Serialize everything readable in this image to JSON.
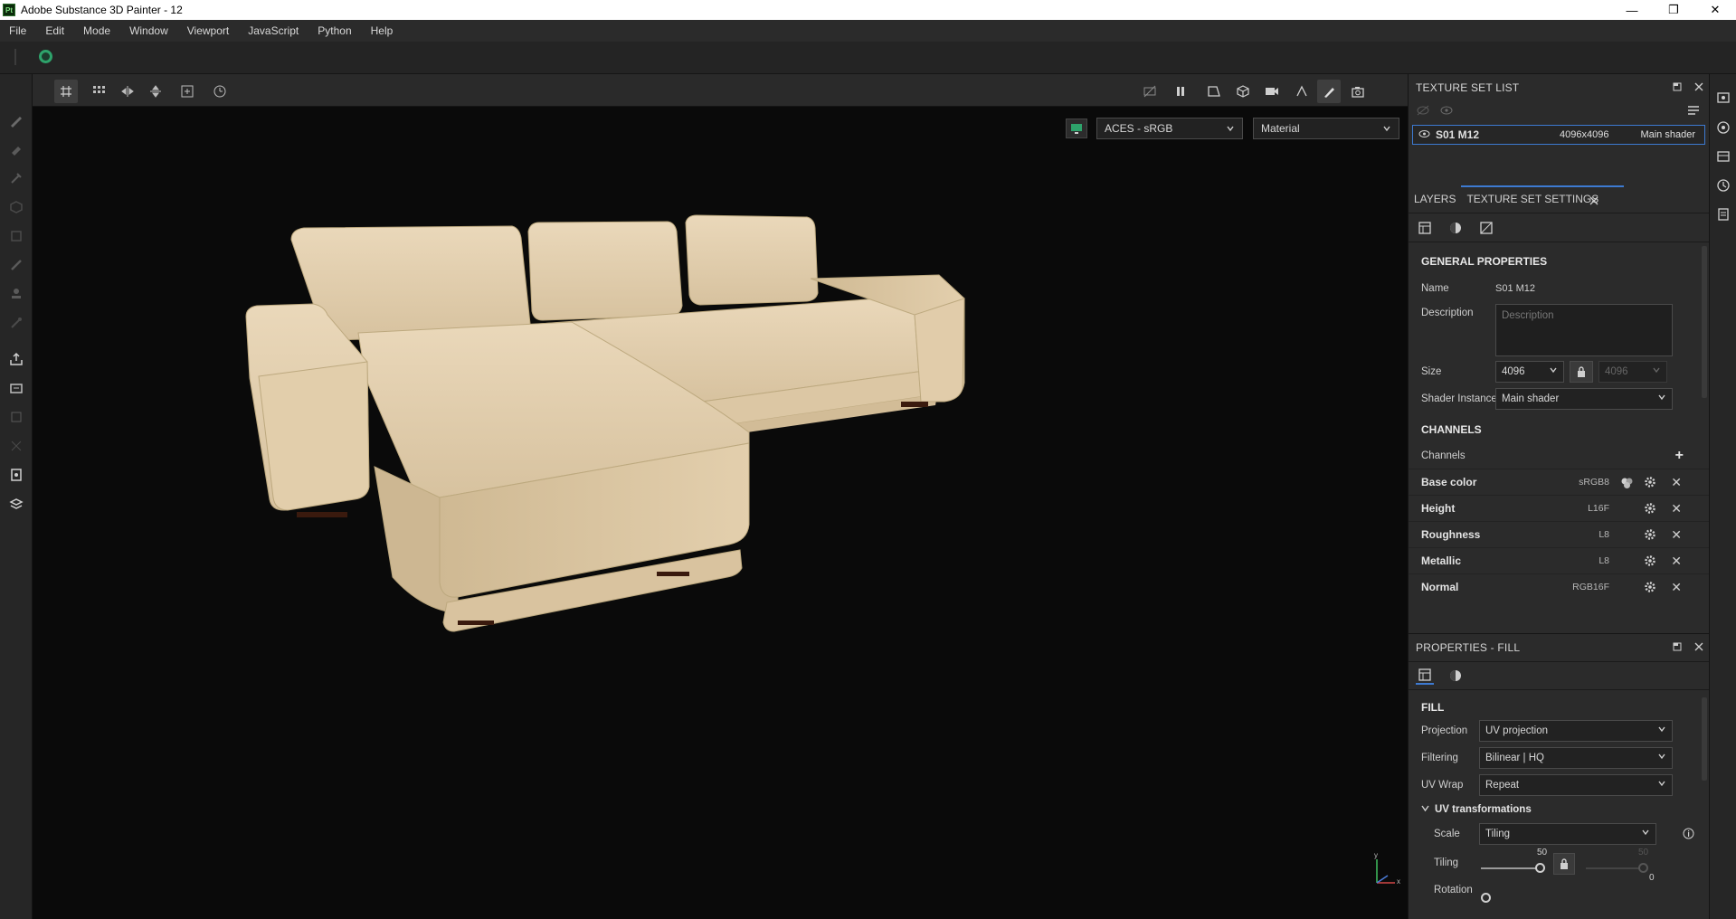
{
  "window": {
    "title": "Adobe Substance 3D Painter - 12",
    "logo_text": "Pt",
    "minimize": "—",
    "maximize": "❐",
    "close": "✕"
  },
  "menu": [
    "File",
    "Edit",
    "Mode",
    "Window",
    "Viewport",
    "JavaScript",
    "Python",
    "Help"
  ],
  "viewport": {
    "colorspace": "ACES - sRGB",
    "display_mode": "Material",
    "axis_x": "x",
    "axis_y": "y"
  },
  "texture_set_list": {
    "header": "TEXTURE SET LIST",
    "row": {
      "name": "S01 M12",
      "resolution": "4096x4096",
      "shader": "Main shader"
    }
  },
  "tabs": {
    "layers": "LAYERS",
    "texture_set_settings": "TEXTURE SET SETTINGS"
  },
  "general": {
    "title": "GENERAL PROPERTIES",
    "name_label": "Name",
    "name_value": "S01 M12",
    "description_label": "Description",
    "description_placeholder": "Description",
    "size_label": "Size",
    "size_value": "4096",
    "size_linked_value": "4096",
    "shader_label": "Shader Instance",
    "shader_value": "Main shader"
  },
  "channels": {
    "title": "CHANNELS",
    "label": "Channels",
    "add": "+",
    "items": [
      {
        "name": "Base color",
        "format": "sRGB8"
      },
      {
        "name": "Height",
        "format": "L16F"
      },
      {
        "name": "Roughness",
        "format": "L8"
      },
      {
        "name": "Metallic",
        "format": "L8"
      },
      {
        "name": "Normal",
        "format": "RGB16F"
      }
    ],
    "remove": "✕"
  },
  "properties_fill": {
    "header": "PROPERTIES - FILL",
    "section": "FILL",
    "projection_label": "Projection",
    "projection_value": "UV projection",
    "filtering_label": "Filtering",
    "filtering_value": "Bilinear | HQ",
    "uvwrap_label": "UV Wrap",
    "uvwrap_value": "Repeat",
    "uvt_title": "UV transformations",
    "scale_label": "Scale",
    "scale_value": "Tiling",
    "tiling_label": "Tiling",
    "tiling_value": "50",
    "tiling_linked_value": "50",
    "rotation_label": "Rotation",
    "rotation_value": "0"
  },
  "colors": {
    "accent": "#3d7ad1",
    "viewport_bg": "#0a0a0a",
    "panel_bg": "#2b2b2b",
    "sofa_fabric": "#e6d3b3"
  }
}
